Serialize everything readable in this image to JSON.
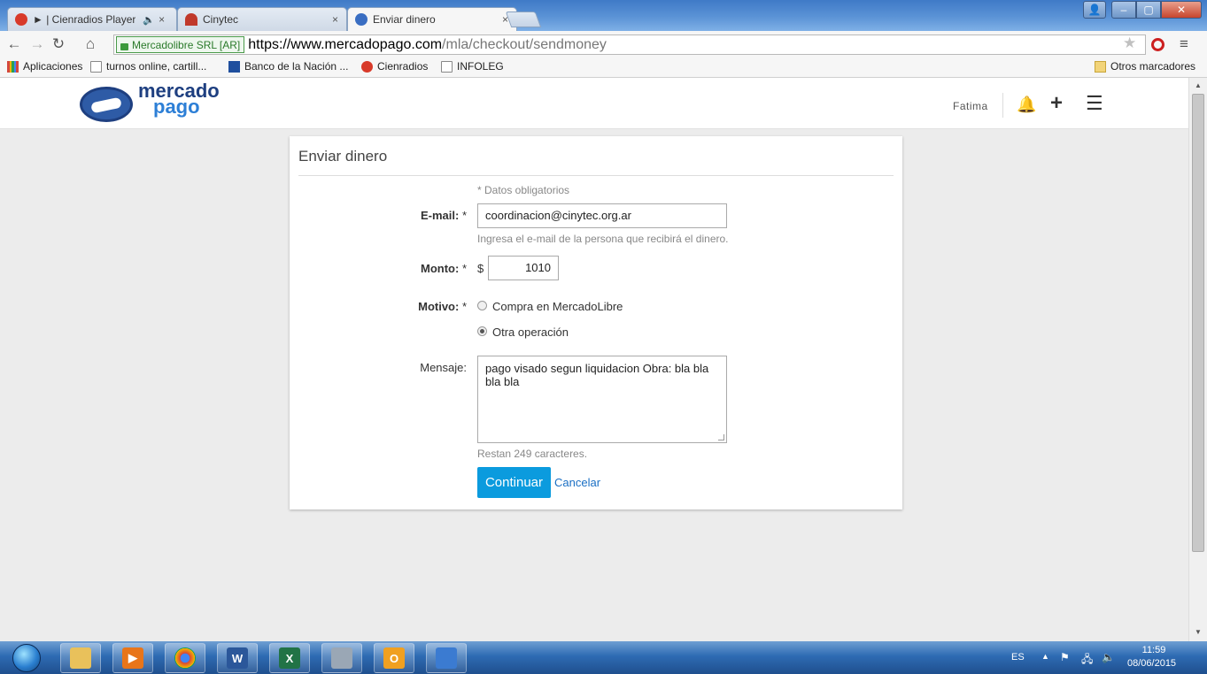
{
  "browser": {
    "tabs": [
      {
        "label": "► | Cienradios Player",
        "audio": "🔈",
        "active": false
      },
      {
        "label": "Cinytec",
        "active": false
      },
      {
        "label": "Enviar dinero",
        "active": true
      }
    ],
    "ev_label": "Mercadolibre SRL [AR]",
    "url_host": "https://www.mercadopago.com",
    "url_path": "/mla/checkout/sendmoney",
    "bookmarks": [
      {
        "label": "Aplicaciones",
        "icon": "apps-grid-icon"
      },
      {
        "label": "turnos online, cartill...",
        "icon": "page-icon"
      },
      {
        "label": "Banco de la Nación ...",
        "icon": "bank-icon"
      },
      {
        "label": "Cienradios",
        "icon": "cienradios-icon"
      },
      {
        "label": "INFOLEG",
        "icon": "page-icon"
      }
    ],
    "other_bookmarks": "Otros marcadores"
  },
  "header": {
    "brand_line1": "mercado",
    "brand_line2": "pago",
    "user": "Fatima"
  },
  "form": {
    "title": "Enviar dinero",
    "required_note": "* Datos obligatorios",
    "email_label": "E-mail:",
    "email_value": "coordinacion@cinytec.org.ar",
    "email_help": "Ingresa el e-mail de la persona que recibirá el dinero.",
    "amount_label": "Monto:",
    "currency": "$",
    "amount_value": "1010",
    "reason_label": "Motivo:",
    "reason_options": [
      "Compra en MercadoLibre",
      "Otra operación"
    ],
    "reason_selected": "Otra operación",
    "message_label": "Mensaje:",
    "message_value": "pago visado segun liquidacion Obra: bla bla bla bla",
    "chars_left": "Restan 249 caracteres.",
    "submit": "Continuar",
    "cancel": "Cancelar"
  },
  "taskbar": {
    "lang": "ES",
    "time": "11:59",
    "date": "08/06/2015"
  },
  "colors": {
    "primary_button": "#0b9bde",
    "link": "#1a6fc4",
    "brand": "#1e3f80"
  }
}
